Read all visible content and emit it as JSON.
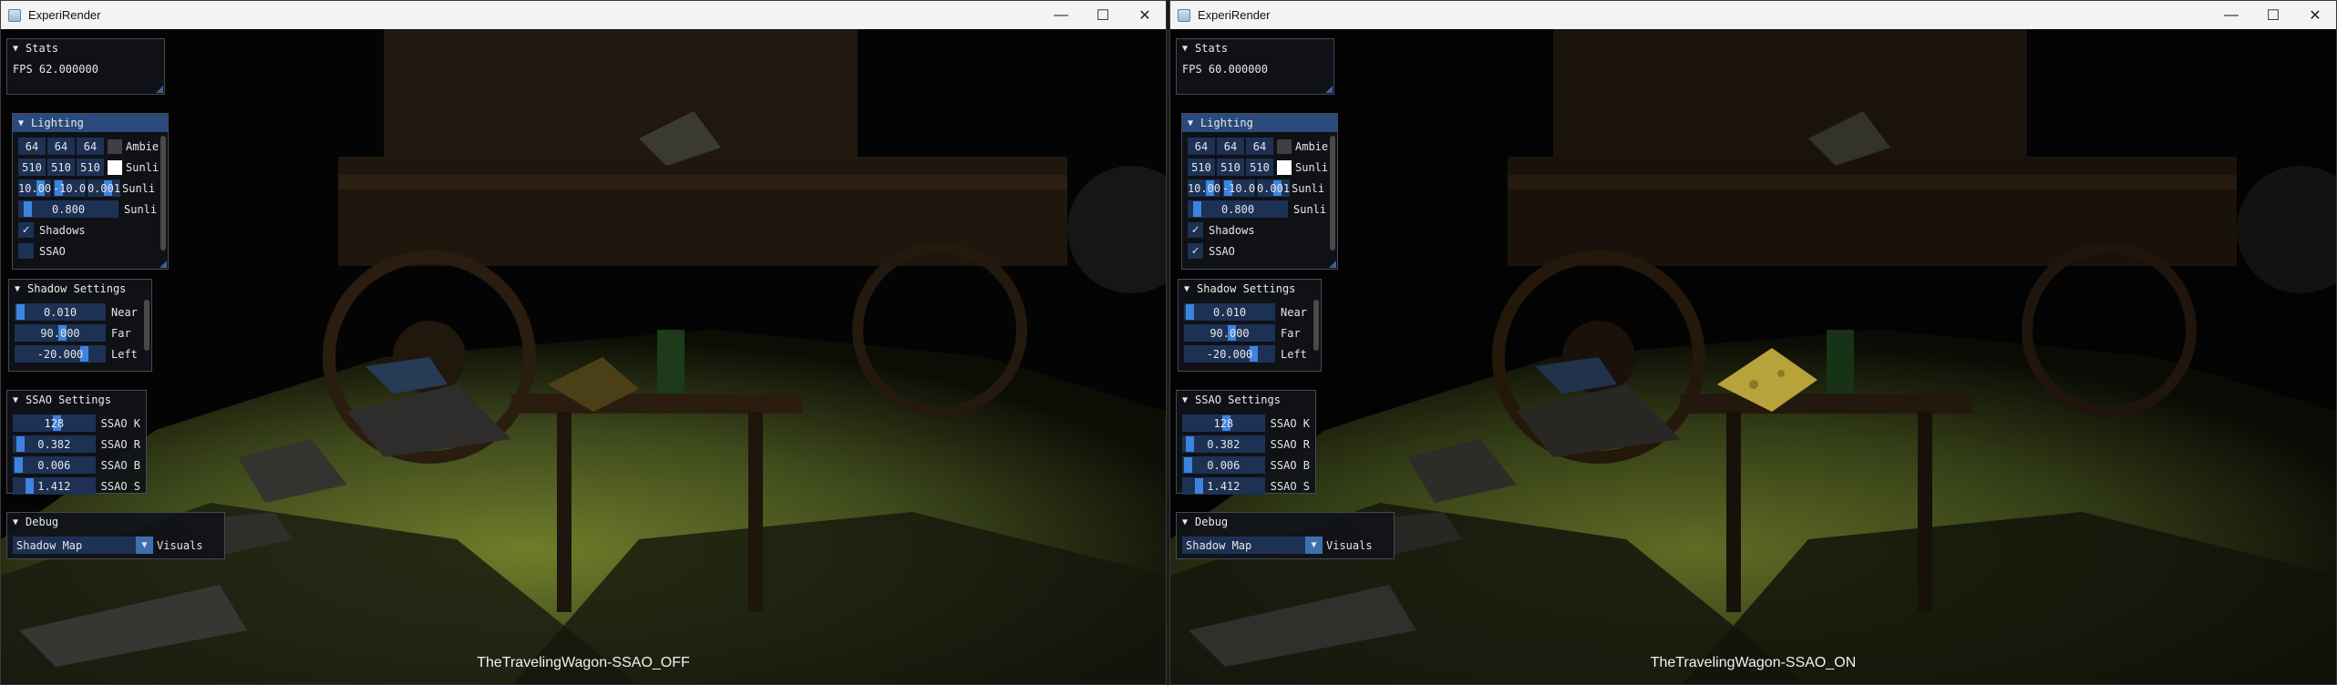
{
  "windows": [
    {
      "title": "ExperiRender",
      "caption": "TheTravelingWagon-SSAO_OFF",
      "controls": {
        "minimize": "—",
        "maximize": "☐",
        "close": "✕"
      },
      "stats": {
        "header": "Stats",
        "fps": "FPS 62.000000"
      },
      "lighting": {
        "header": "Lighting",
        "ambient": {
          "r": "64",
          "g": "64",
          "b": "64",
          "label": "Ambie",
          "color": "#404040"
        },
        "sun_color": {
          "r": "510",
          "g": "510",
          "b": "510",
          "label": "Sunli",
          "color": "#ffffff"
        },
        "sun_dir": {
          "x": "10.00",
          "y": "-10.0",
          "z": "0.001",
          "label": "Sunli"
        },
        "sun_intensity": {
          "value": "0.800",
          "label": "Sunli"
        },
        "shadows": {
          "label": "Shadows",
          "checked": true
        },
        "ssao": {
          "label": "SSAO",
          "checked": false
        }
      },
      "shadow_settings": {
        "header": "Shadow Settings",
        "near": {
          "value": "0.010",
          "label": "Near"
        },
        "far": {
          "value": "90.000",
          "label": "Far"
        },
        "left": {
          "value": "-20.000",
          "label": "Left"
        }
      },
      "ssao_settings": {
        "header": "SSAO Settings",
        "kernel": {
          "value": "128",
          "label": "SSAO K"
        },
        "radius": {
          "value": "0.382",
          "label": "SSAO R"
        },
        "bias": {
          "value": "0.006",
          "label": "SSAO B"
        },
        "strength": {
          "value": "1.412",
          "label": "SSAO S"
        }
      },
      "debug": {
        "header": "Debug",
        "selected": "Shadow Map",
        "label": "Visuals"
      }
    },
    {
      "title": "ExperiRender",
      "caption": "TheTravelingWagon-SSAO_ON",
      "controls": {
        "minimize": "—",
        "maximize": "☐",
        "close": "✕"
      },
      "stats": {
        "header": "Stats",
        "fps": "FPS 60.000000"
      },
      "lighting": {
        "header": "Lighting",
        "ambient": {
          "r": "64",
          "g": "64",
          "b": "64",
          "label": "Ambie",
          "color": "#404040"
        },
        "sun_color": {
          "r": "510",
          "g": "510",
          "b": "510",
          "label": "Sunli",
          "color": "#ffffff"
        },
        "sun_dir": {
          "x": "10.00",
          "y": "-10.0",
          "z": "0.001",
          "label": "Sunli"
        },
        "sun_intensity": {
          "value": "0.800",
          "label": "Sunli"
        },
        "shadows": {
          "label": "Shadows",
          "checked": true
        },
        "ssao": {
          "label": "SSAO",
          "checked": true
        }
      },
      "shadow_settings": {
        "header": "Shadow Settings",
        "near": {
          "value": "0.010",
          "label": "Near"
        },
        "far": {
          "value": "90.000",
          "label": "Far"
        },
        "left": {
          "value": "-20.000",
          "label": "Left"
        }
      },
      "ssao_settings": {
        "header": "SSAO Settings",
        "kernel": {
          "value": "128",
          "label": "SSAO K"
        },
        "radius": {
          "value": "0.382",
          "label": "SSAO R"
        },
        "bias": {
          "value": "0.006",
          "label": "SSAO B"
        },
        "strength": {
          "value": "1.412",
          "label": "SSAO S"
        }
      },
      "debug": {
        "header": "Debug",
        "selected": "Shadow Map",
        "label": "Visuals"
      }
    }
  ],
  "theme": {
    "accent": "#3d84df",
    "frame_bg": "#1d3154",
    "header_active": "#294a7a",
    "ground": "#6f7d2a"
  }
}
